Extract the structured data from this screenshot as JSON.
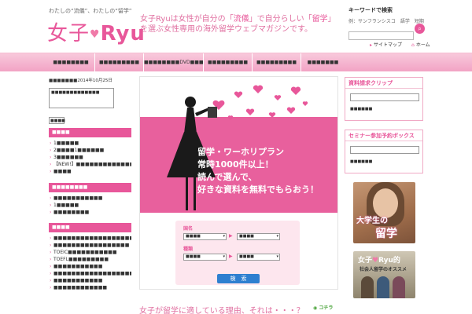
{
  "header": {
    "tagline": "わたしの“流儀”、わたしの“留学”",
    "logo_jp": "女子",
    "logo_latin": "Ryu",
    "headline_pre": "女子Ryuは女性が自分の「",
    "headline_hl1": "流儀",
    "headline_mid": "」で自分らしい「",
    "headline_hl2": "留学",
    "headline_post": "」を選ぶ女性専用の海外留学ウェブマガジンです。",
    "search_title": "キーワードで検索",
    "search_example": "例：サンフランシスコ　語学　短期",
    "search_value": "",
    "search_button_icon": "search-icon",
    "sitemap": "サイトマップ",
    "home": "ホーム"
  },
  "nav": [
    "■■■■■■■■",
    "■■■■■■■■■",
    "■■■■■■■■DVD■■■",
    "■■■■■■■■■",
    "■■■■■■■■■",
    "■■■■■■■"
  ],
  "left": {
    "breadcrumb": "■■■■■■■2014年10月25日",
    "adbox_text": "■■■■■■■■■■■■■",
    "small_input": "■■■■",
    "sections": [
      {
        "title": "■■■■",
        "items": [
          "1■■■■■",
          "2■■■■1■■■■■■",
          "3■■■■■■",
          "【NEW!】■■■■■■■■■■■■■■■■■",
          "■■■■"
        ]
      },
      {
        "title": "■■■■■■■■",
        "items": [
          "■■■■■■■■■■■",
          "1■■■■■",
          "■■■■■■■■"
        ]
      },
      {
        "title": "■■■■",
        "items": [
          "■■■■■■■■■■■■■■■■■■■■",
          "■■■■■■■■■■■■■■■■■",
          "TOEIC■■■■■■■■■■■",
          "TOEFL■■■■■■■■■",
          "■■■■■■■■■■■",
          "■■■■■■■■■■■■■■■■■■■■",
          "■■■■■■■■■■■",
          "■■■■■■■■■■■■"
        ]
      }
    ]
  },
  "main": {
    "promo_lines": [
      "留学・ワーホリプラン",
      "常時1000件以上！",
      "読んで選んで、",
      "好きな資料を無料でもらおう！"
    ],
    "form": {
      "label_country": "国名",
      "label_type": "種類",
      "select1": "■■■■",
      "select2": "■■■■",
      "select3": "■■■■",
      "select4": "■■■■",
      "submit": "検　索"
    },
    "tail_question": "女子が留学に適している理由、それは・・・？",
    "tail_link": "コチラ"
  },
  "right": {
    "box1_title": "資料請求クリップ",
    "box1_tag": "■■■■■■",
    "box2_title": "セミナー参加予約ボックス",
    "box2_tag": "■■■■■■",
    "ad1_line1": "大学生の",
    "ad1_line2": "留学",
    "ad2_title_a": "女子",
    "ad2_title_b": "Ryu",
    "ad2_title_c": "的",
    "ad2_sub": "社会人留学のオススメ"
  },
  "colors": {
    "brand_pink": "#e8579a",
    "nav_pink": "#f2a3c4",
    "button_blue": "#2e7fd0",
    "link_green": "#4aa43a"
  }
}
